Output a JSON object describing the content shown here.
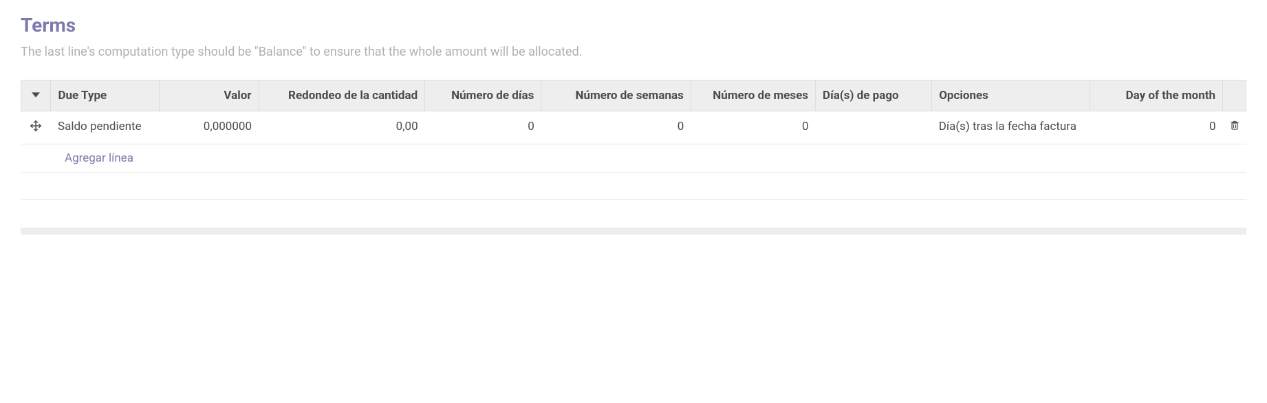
{
  "section": {
    "title": "Terms",
    "subtitle": "The last line's computation type should be \"Balance\" to ensure that the whole amount will be allocated."
  },
  "table": {
    "headers": {
      "due_type": "Due Type",
      "valor": "Valor",
      "redondeo": "Redondeo de la cantidad",
      "num_dias": "Número de días",
      "num_semanas": "Número de semanas",
      "num_meses": "Número de meses",
      "dias_pago": "Día(s) de pago",
      "opciones": "Opciones",
      "day_of_month": "Day of the month"
    },
    "rows": [
      {
        "due_type": "Saldo pendiente",
        "valor": "0,000000",
        "redondeo": "0,00",
        "num_dias": "0",
        "num_semanas": "0",
        "num_meses": "0",
        "dias_pago": "",
        "opciones": "Día(s) tras la fecha factura",
        "day_of_month": "0"
      }
    ],
    "add_line_label": "Agregar línea"
  }
}
